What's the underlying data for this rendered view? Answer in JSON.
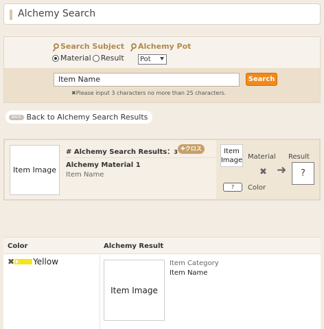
{
  "header": {
    "title": "Alchemy Search"
  },
  "search": {
    "subject_label": "Search Subject",
    "pot_label": "Alchemy Pot",
    "radio_material": "Material",
    "radio_result": "Result",
    "radio_selected": "Material",
    "pot_value": "Pot",
    "input_value": "Item Name",
    "button_label": "Search",
    "hint": "✖Please input 3 characters no more than 25 characters."
  },
  "back": {
    "badge": "BACK",
    "label": "Back to Alchemy Search Results"
  },
  "results": {
    "heading": "# Alchemy Search Results：",
    "count": "3",
    "badge": "✚クロス",
    "image_label": "Item Image",
    "material_name": "Alchemy Material 1",
    "material_sub": "Item Name",
    "recipe": {
      "image_label": "Item Image",
      "material_label": "Material",
      "result_label": "Result",
      "color_label": "Color",
      "unknown": "?"
    }
  },
  "table": {
    "headers": [
      "Color",
      "Alchemy Result"
    ],
    "rows": [
      {
        "color_mark": "✖",
        "color": "Yellow",
        "color_hex": "#f4e51e",
        "image_label": "Item Image",
        "category": "Item Category",
        "name": "Item Name"
      }
    ]
  },
  "colors": {
    "accent": "#f08a1c",
    "brand_gold": "#b08a4e",
    "background": "#f3ece2"
  },
  "icons": [
    "search-icon",
    "back-icon",
    "cross-icon",
    "arrow-right-icon",
    "dropdown-icon"
  ]
}
